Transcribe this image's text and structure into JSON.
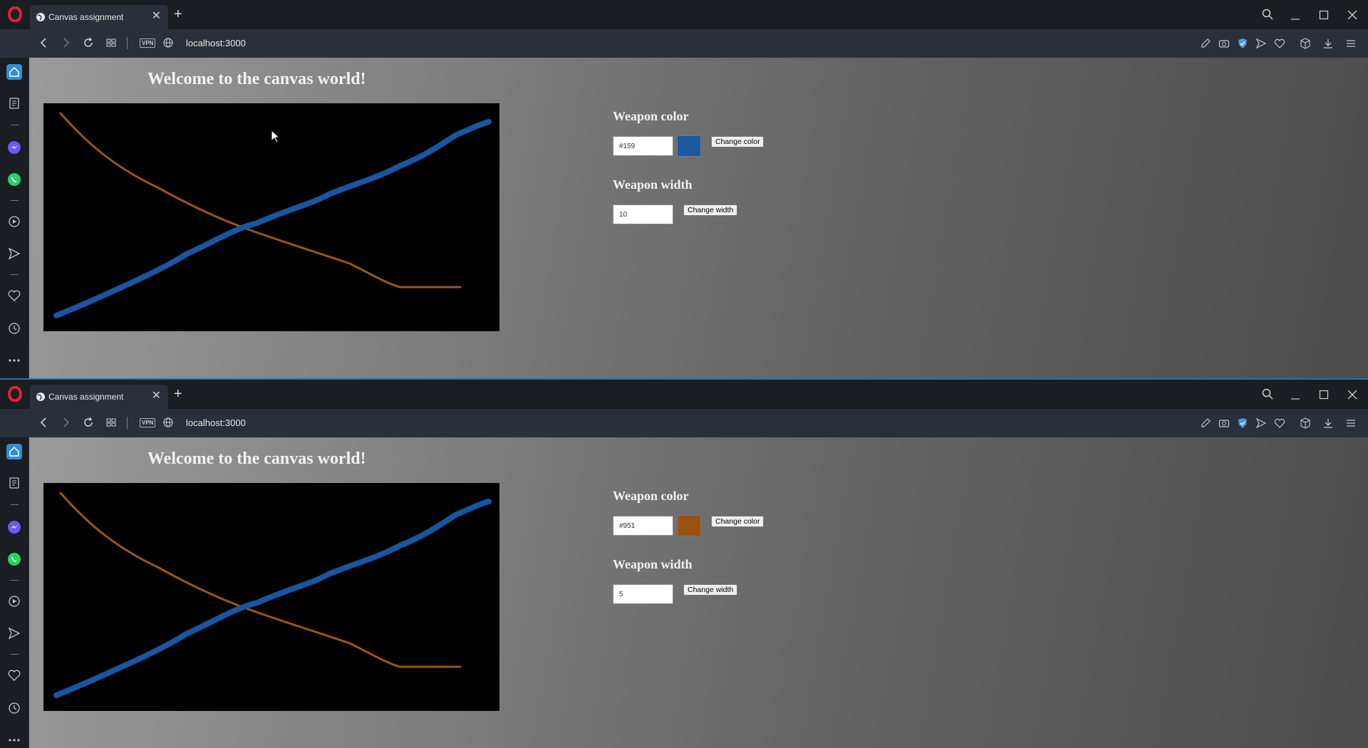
{
  "windows": [
    {
      "tab": {
        "title": "Canvas assignment",
        "close": "✕"
      },
      "address": {
        "url": "localhost:3000",
        "vpn": "VPN"
      },
      "page": {
        "heading": "Welcome to the canvas world!",
        "color_section": {
          "title": "Weapon color",
          "value": "#159",
          "swatch": "#1a5aa0",
          "button": "Change color"
        },
        "width_section": {
          "title": "Weapon width",
          "value": "10",
          "button": "Change width"
        }
      }
    },
    {
      "tab": {
        "title": "Canvas assignment",
        "close": "✕"
      },
      "address": {
        "url": "localhost:3000",
        "vpn": "VPN"
      },
      "page": {
        "heading": "Welcome to the canvas world!",
        "color_section": {
          "title": "Weapon color",
          "value": "#951",
          "swatch": "#9a5210",
          "button": "Change color"
        },
        "width_section": {
          "title": "Weapon width",
          "value": "5",
          "button": "Change width"
        }
      }
    }
  ],
  "canvas_strokes": {
    "orange": {
      "color": "#9b5518",
      "width": 3
    },
    "blue": {
      "color": "#1a55a0",
      "width": 8
    }
  }
}
